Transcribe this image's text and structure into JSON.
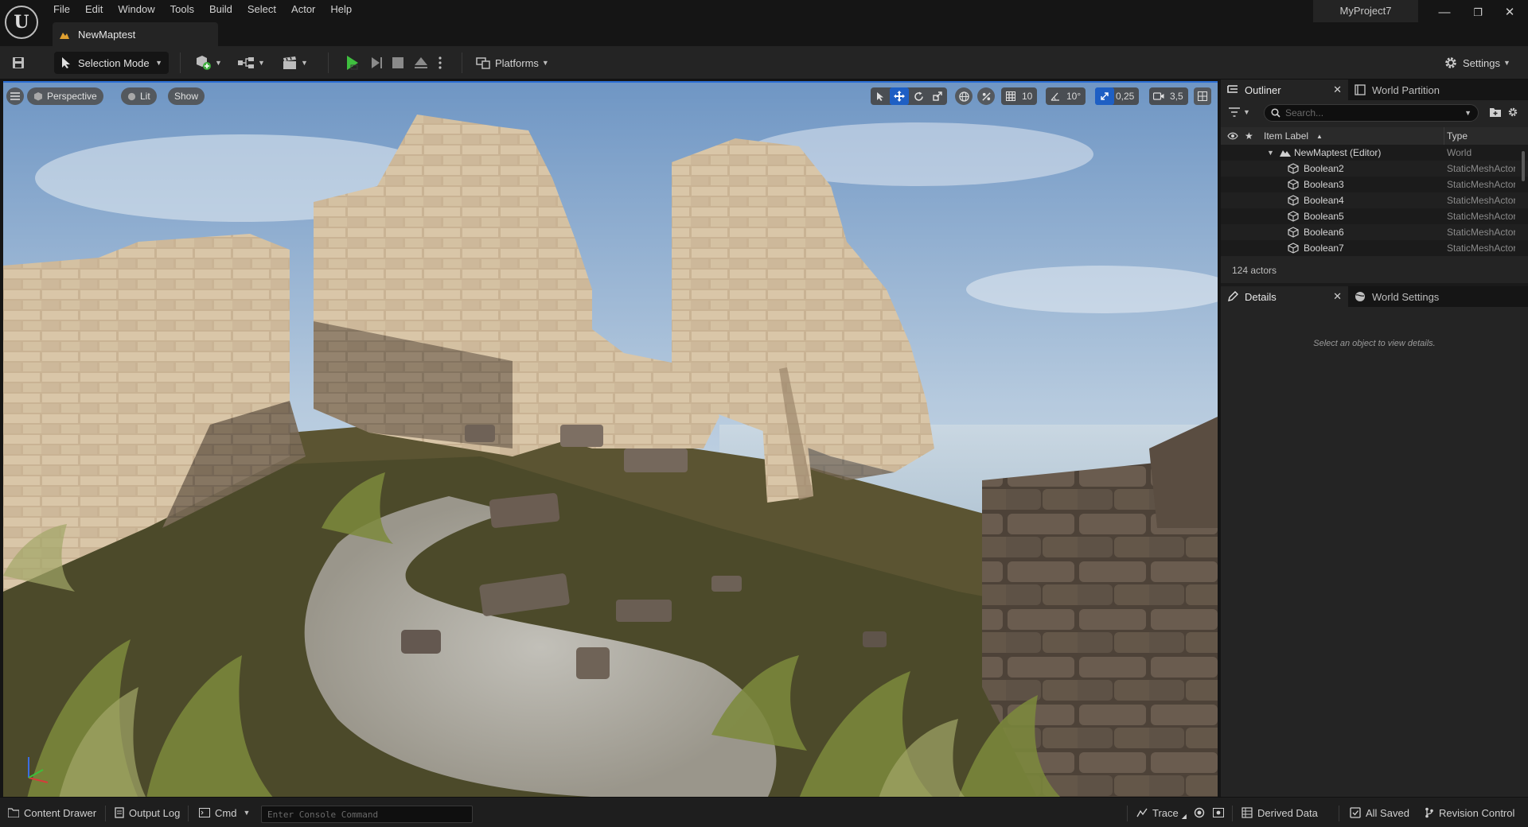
{
  "app": {
    "logo_text": "U",
    "menu": [
      "File",
      "Edit",
      "Window",
      "Tools",
      "Build",
      "Select",
      "Actor",
      "Help"
    ],
    "level_tab": "NewMaptest",
    "project_name": "MyProject7",
    "window_controls": {
      "minimize": "—",
      "restore": "❐",
      "close": "✕"
    }
  },
  "toolbar": {
    "mode": "Selection Mode",
    "platforms": "Platforms",
    "settings": "Settings"
  },
  "viewport": {
    "view_mode": "Perspective",
    "lighting": "Lit",
    "show": "Show",
    "grid_snap": "10",
    "rotation_snap": "10°",
    "scale_snap": "0,25",
    "camera_speed": "3,5",
    "colors": {
      "active": "#1e5fc4",
      "sky_top": "#7a9fc8",
      "sky_bottom": "#dbe6ef"
    }
  },
  "outliner": {
    "tab_label": "Outliner",
    "second_tab": "World Partition",
    "search_placeholder": "Search...",
    "col_label": "Item Label",
    "col_type": "Type",
    "root": {
      "label": "NewMaptest (Editor)",
      "type": "World"
    },
    "items": [
      {
        "label": "Boolean2",
        "type": "StaticMeshActor"
      },
      {
        "label": "Boolean3",
        "type": "StaticMeshActor"
      },
      {
        "label": "Boolean4",
        "type": "StaticMeshActor"
      },
      {
        "label": "Boolean5",
        "type": "StaticMeshActor"
      },
      {
        "label": "Boolean6",
        "type": "StaticMeshActor"
      },
      {
        "label": "Boolean7",
        "type": "StaticMeshActor"
      }
    ],
    "actor_count": "124 actors"
  },
  "details": {
    "tab_label": "Details",
    "second_tab": "World Settings",
    "empty_text": "Select an object to view details."
  },
  "statusbar": {
    "content_drawer": "Content Drawer",
    "output_log": "Output Log",
    "cmd": "Cmd",
    "console_placeholder": "Enter Console Command",
    "trace": "Trace",
    "derived_data": "Derived Data",
    "all_saved": "All Saved",
    "revision_control": "Revision Control"
  }
}
